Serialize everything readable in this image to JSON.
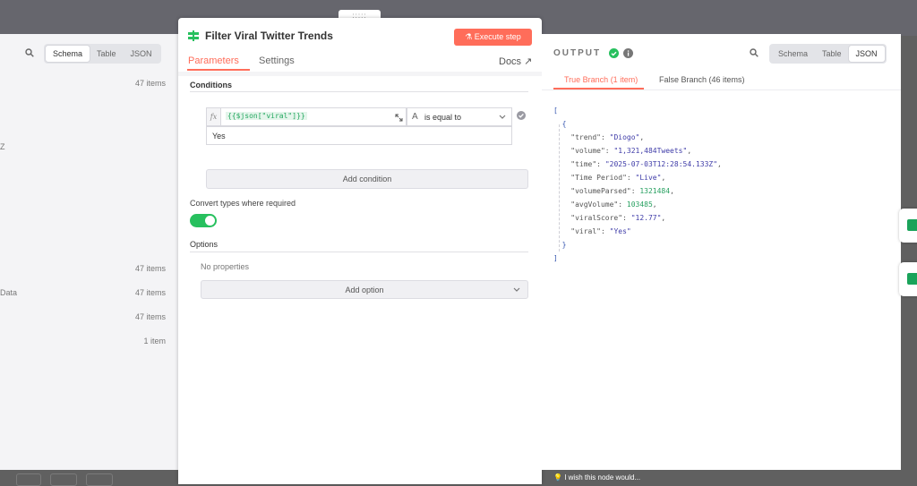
{
  "input_panel": {
    "view_tabs": [
      "Schema",
      "Table",
      "JSON"
    ],
    "active_view": "Schema",
    "rows": [
      {
        "label": "",
        "count": "47 items"
      },
      {
        "label": "Z",
        "count": ""
      },
      {
        "label": "",
        "count": "47 items"
      },
      {
        "label": "Data",
        "count": "47 items"
      },
      {
        "label": "",
        "count": "47 items"
      },
      {
        "label": "",
        "count": "1 item"
      }
    ]
  },
  "node": {
    "title": "Filter Viral Twitter Trends",
    "execute_label": "Execute step",
    "tabs": [
      "Parameters",
      "Settings"
    ],
    "active_tab": "Parameters",
    "docs_label": "Docs",
    "conditions_label": "Conditions",
    "fx_label": "fx",
    "condition_expression": "{{$json[\"viral\"]}}",
    "operator_label": "is equal to",
    "operator_type_icon": "text-type-icon",
    "condition_value": "Yes",
    "add_condition_label": "Add condition",
    "convert_types_label": "Convert types where required",
    "convert_types_enabled": true,
    "options_label": "Options",
    "no_properties_label": "No properties",
    "add_option_label": "Add option"
  },
  "output_panel": {
    "label": "OUTPUT",
    "view_tabs": [
      "Schema",
      "Table",
      "JSON"
    ],
    "active_view": "JSON",
    "branches": [
      "True Branch (1 item)",
      "False Branch (46 items)"
    ],
    "active_branch": "True Branch (1 item)",
    "json_item": [
      {
        "key": "trend",
        "value": "\"Diogo\"",
        "kind": "s"
      },
      {
        "key": "volume",
        "value": "\"1,321,484Tweets\"",
        "kind": "s"
      },
      {
        "key": "time",
        "value": "\"2025-07-03T12:28:54.133Z\"",
        "kind": "s"
      },
      {
        "key": "Time Period",
        "value": "\"Live\"",
        "kind": "s"
      },
      {
        "key": "volumeParsed",
        "value": "1321484",
        "kind": "n"
      },
      {
        "key": "avgVolume",
        "value": "103485",
        "kind": "n"
      },
      {
        "key": "viralScore",
        "value": "\"12.77\"",
        "kind": "s"
      },
      {
        "key": "viral",
        "value": "\"Yes\"",
        "kind": "s"
      }
    ]
  },
  "feedback_label": "I wish this node would...",
  "colors": {
    "accent": "#ff6d5a",
    "success": "#27c05e",
    "expression_green": "#25a860",
    "json_string": "#3f3ca8",
    "json_number": "#27a060"
  }
}
